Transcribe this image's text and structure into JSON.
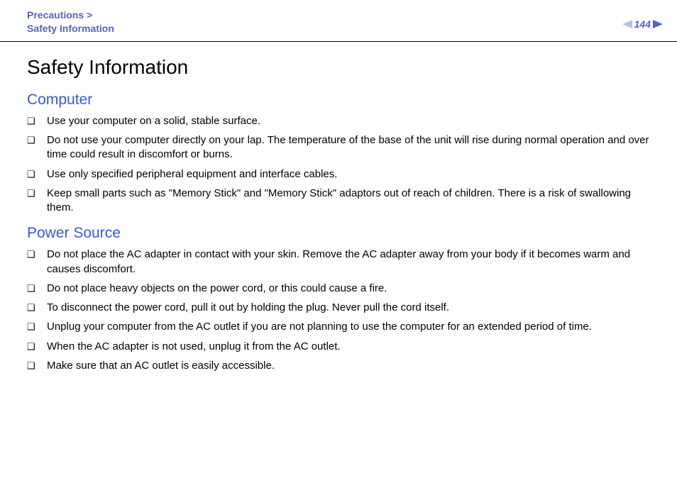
{
  "header": {
    "breadcrumb_top": "Precautions >",
    "breadcrumb_bottom": "Safety Information",
    "page_number": "144"
  },
  "main": {
    "title": "Safety Information",
    "sections": [
      {
        "heading": "Computer",
        "items": [
          "Use your computer on a solid, stable surface.",
          "Do not use your computer directly on your lap. The temperature of the base of the unit will rise during normal operation and over time could result in discomfort or burns.",
          "Use only specified peripheral equipment and interface cables.",
          "Keep small parts such as \"Memory Stick\" and \"Memory Stick\" adaptors out of reach of children. There is a risk of swallowing them."
        ]
      },
      {
        "heading": "Power Source",
        "items": [
          "Do not place the AC adapter in contact with your skin. Remove the AC adapter away from your body if it becomes warm and causes discomfort.",
          "Do not place heavy objects on the power cord, or this could cause a fire.",
          "To disconnect the power cord, pull it out by holding the plug. Never pull the cord itself.",
          "Unplug your computer from the AC outlet if you are not planning to use the computer for an extended period of time.",
          "When the AC adapter is not used, unplug it from the AC outlet.",
          "Make sure that an AC outlet is easily accessible."
        ]
      }
    ]
  }
}
